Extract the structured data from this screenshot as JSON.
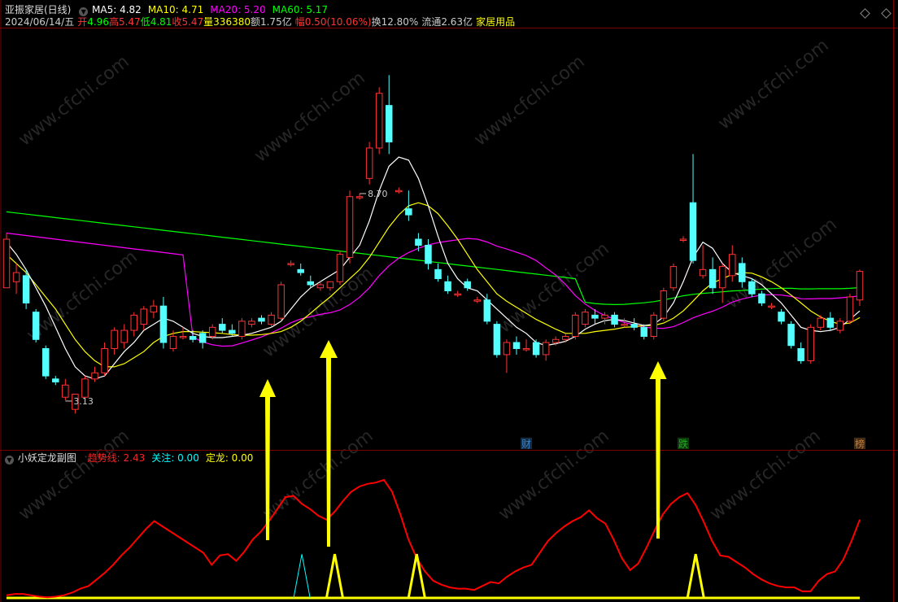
{
  "header": {
    "title": "亚振家居(日线)",
    "ma": [
      {
        "label": "MA5: 4.82",
        "color": "#ffffff"
      },
      {
        "label": "MA10: 4.71",
        "color": "#ffff00"
      },
      {
        "label": "MA20: 5.20",
        "color": "#ff00ff"
      },
      {
        "label": "MA60: 5.17",
        "color": "#00ff00"
      }
    ],
    "quote": [
      {
        "text": "2024/06/14/五",
        "color": "#cccccc"
      },
      {
        "text": "开",
        "color": "#ff3333"
      },
      {
        "text": "4.96",
        "color": "#00ff00"
      },
      {
        "text": "高",
        "color": "#ff3333"
      },
      {
        "text": "5.47",
        "color": "#ff3333"
      },
      {
        "text": "低",
        "color": "#00ff00"
      },
      {
        "text": "4.81",
        "color": "#00ff00"
      },
      {
        "text": "收",
        "color": "#ff3333"
      },
      {
        "text": "5.47",
        "color": "#ff3333"
      },
      {
        "text": "量",
        "color": "#ffff00"
      },
      {
        "text": "336380",
        "color": "#ffff00"
      },
      {
        "text": "额1.75亿",
        "color": "#cccccc"
      },
      {
        "text": "幅",
        "color": "#ff3333"
      },
      {
        "text": "0.50(10.06%)",
        "color": "#ff3333"
      },
      {
        "text": "换12.80%",
        "color": "#cccccc"
      },
      {
        "text": "流通2.63亿",
        "color": "#cccccc"
      },
      {
        "text": "家居用品",
        "color": "#ffff00"
      }
    ]
  },
  "sub_header": {
    "title": "小妖定龙副图",
    "items": [
      {
        "text": "趋势线: 2.43",
        "color": "#ff2222"
      },
      {
        "text": "关注: 0.00",
        "color": "#00ffff"
      },
      {
        "text": "定龙: 0.00",
        "color": "#ffff00"
      }
    ]
  },
  "watermark": "www.cfchi.com",
  "markers": [
    {
      "text": "财",
      "color": "#3b82c4",
      "index": 53
    },
    {
      "text": "跌",
      "color": "#22aa22",
      "index": 69
    },
    {
      "text": "榜",
      "color": "#c27c3a",
      "index": 87
    }
  ],
  "price_labels": [
    {
      "text": "8.70",
      "index": 36
    },
    {
      "text": "3.13",
      "index": 6
    }
  ],
  "colors": {
    "up": "#ff3333",
    "down": "#54ffff",
    "ma5": "#ffffff",
    "ma10": "#ffff00",
    "ma20": "#ff00ff",
    "ma60": "#00ff00",
    "trend": "#ff0000",
    "focus": "#00ffff",
    "dragon": "#ffff00",
    "arrow": "#ffff00",
    "panel_border": "#7a0000"
  },
  "chart_data": [
    {
      "type": "candlestick",
      "title": "亚振家居(日线)",
      "ylim": [
        2.6,
        9.4
      ],
      "candles": [
        [
          5.2,
          6.1,
          5.25,
          6.0
        ],
        [
          5.3,
          5.6,
          5.1,
          5.45
        ],
        [
          5.4,
          5.5,
          4.85,
          4.95
        ],
        [
          4.8,
          4.85,
          4.3,
          4.35
        ],
        [
          4.2,
          4.25,
          3.7,
          3.75
        ],
        [
          3.7,
          3.75,
          3.6,
          3.65
        ],
        [
          3.4,
          3.7,
          3.35,
          3.6
        ],
        [
          3.2,
          3.45,
          3.13,
          3.45
        ],
        [
          3.4,
          3.75,
          3.35,
          3.7
        ],
        [
          3.7,
          3.9,
          3.65,
          3.8
        ],
        [
          3.8,
          4.3,
          3.75,
          4.2
        ],
        [
          4.2,
          4.55,
          4.1,
          4.5
        ],
        [
          4.3,
          4.6,
          4.2,
          4.5
        ],
        [
          4.5,
          4.8,
          4.4,
          4.75
        ],
        [
          4.6,
          4.9,
          4.5,
          4.85
        ],
        [
          4.8,
          5.0,
          4.7,
          4.9
        ],
        [
          4.9,
          5.05,
          4.2,
          4.3
        ],
        [
          4.2,
          4.5,
          4.15,
          4.4
        ],
        [
          4.4,
          4.55,
          4.35,
          4.4
        ],
        [
          4.4,
          4.5,
          4.3,
          4.35
        ],
        [
          4.45,
          4.5,
          4.2,
          4.3
        ],
        [
          4.4,
          4.6,
          4.35,
          4.55
        ],
        [
          4.6,
          4.7,
          4.45,
          4.5
        ],
        [
          4.5,
          4.6,
          4.4,
          4.45
        ],
        [
          4.4,
          4.7,
          4.35,
          4.65
        ],
        [
          4.6,
          4.7,
          4.55,
          4.65
        ],
        [
          4.7,
          4.75,
          4.6,
          4.65
        ],
        [
          4.6,
          4.8,
          4.55,
          4.75
        ],
        [
          4.7,
          5.3,
          4.65,
          5.25
        ],
        [
          5.6,
          5.65,
          5.55,
          5.6
        ],
        [
          5.5,
          5.6,
          5.4,
          5.45
        ],
        [
          5.3,
          5.4,
          5.2,
          5.25
        ],
        [
          5.2,
          5.3,
          5.15,
          5.25
        ],
        [
          5.2,
          5.3,
          5.15,
          5.3
        ],
        [
          5.3,
          5.8,
          5.25,
          5.75
        ],
        [
          5.7,
          6.8,
          5.6,
          6.7
        ],
        [
          6.7,
          6.75,
          6.65,
          6.7
        ],
        [
          7.0,
          7.6,
          6.9,
          7.5
        ],
        [
          7.5,
          8.5,
          7.4,
          8.4
        ],
        [
          8.2,
          8.7,
          7.4,
          7.6
        ],
        [
          6.8,
          6.85,
          6.75,
          6.8
        ],
        [
          6.5,
          6.8,
          6.3,
          6.4
        ],
        [
          6.0,
          6.1,
          5.8,
          5.9
        ],
        [
          5.9,
          6.0,
          5.5,
          5.6
        ],
        [
          5.5,
          5.6,
          5.3,
          5.35
        ],
        [
          5.3,
          5.4,
          5.1,
          5.15
        ],
        [
          5.1,
          5.15,
          5.05,
          5.1
        ],
        [
          5.3,
          5.35,
          5.15,
          5.2
        ],
        [
          5.0,
          5.05,
          4.95,
          5.0
        ],
        [
          5.0,
          5.1,
          4.6,
          4.65
        ],
        [
          4.6,
          4.65,
          4.05,
          4.1
        ],
        [
          4.1,
          4.35,
          3.8,
          4.3
        ],
        [
          4.3,
          4.4,
          4.1,
          4.2
        ],
        [
          4.2,
          4.35,
          4.15,
          4.2
        ],
        [
          4.3,
          4.35,
          4.05,
          4.1
        ],
        [
          4.1,
          4.35,
          4.0,
          4.3
        ],
        [
          4.3,
          4.4,
          4.25,
          4.35
        ],
        [
          4.35,
          4.45,
          4.3,
          4.4
        ],
        [
          4.4,
          4.8,
          4.35,
          4.75
        ],
        [
          4.6,
          4.85,
          4.55,
          4.8
        ],
        [
          4.75,
          4.85,
          4.6,
          4.7
        ],
        [
          4.7,
          4.8,
          4.6,
          4.75
        ],
        [
          4.75,
          4.8,
          4.55,
          4.6
        ],
        [
          4.6,
          4.7,
          4.55,
          4.6
        ],
        [
          4.6,
          4.7,
          4.5,
          4.55
        ],
        [
          4.55,
          4.6,
          4.35,
          4.4
        ],
        [
          4.4,
          4.8,
          4.35,
          4.75
        ],
        [
          4.7,
          5.2,
          4.65,
          5.15
        ],
        [
          5.2,
          5.6,
          5.15,
          5.55
        ],
        [
          6.0,
          6.05,
          5.95,
          6.0
        ],
        [
          6.6,
          7.4,
          5.6,
          5.65
        ],
        [
          5.4,
          5.9,
          5.35,
          5.5
        ],
        [
          5.5,
          5.7,
          5.1,
          5.2
        ],
        [
          5.2,
          5.6,
          4.95,
          5.55
        ],
        [
          5.4,
          5.9,
          5.3,
          5.75
        ],
        [
          5.6,
          5.7,
          5.2,
          5.3
        ],
        [
          5.3,
          5.35,
          5.05,
          5.1
        ],
        [
          5.1,
          5.15,
          4.9,
          4.95
        ],
        [
          4.9,
          4.95,
          4.85,
          4.9
        ],
        [
          4.8,
          4.85,
          4.6,
          4.65
        ],
        [
          4.6,
          4.65,
          4.2,
          4.25
        ],
        [
          4.2,
          4.3,
          3.95,
          4.0
        ],
        [
          4.0,
          4.6,
          3.95,
          4.55
        ],
        [
          4.55,
          4.75,
          4.5,
          4.7
        ],
        [
          4.7,
          4.8,
          4.5,
          4.55
        ],
        [
          4.5,
          4.7,
          4.45,
          4.65
        ],
        [
          4.65,
          5.1,
          4.6,
          5.05
        ],
        [
          5.0,
          5.5,
          4.9,
          5.47
        ]
      ],
      "ma5": [
        5.95,
        5.75,
        5.5,
        5.2,
        4.9,
        4.55,
        4.2,
        3.9,
        3.75,
        3.7,
        3.75,
        3.95,
        4.15,
        4.3,
        4.5,
        4.6,
        4.7,
        4.65,
        4.55,
        4.45,
        4.4,
        4.38,
        4.38,
        4.4,
        4.42,
        4.45,
        4.5,
        4.55,
        4.65,
        4.85,
        5.05,
        5.2,
        5.3,
        5.4,
        5.5,
        5.7,
        5.9,
        6.3,
        6.8,
        7.2,
        7.35,
        7.3,
        7.0,
        6.55,
        6.05,
        5.6,
        5.35,
        5.2,
        5.15,
        5.0,
        4.85,
        4.7,
        4.55,
        4.45,
        4.3,
        4.25,
        4.28,
        4.32,
        4.4,
        4.52,
        4.6,
        4.66,
        4.68,
        4.66,
        4.62,
        4.58,
        4.6,
        4.72,
        4.95,
        5.3,
        5.7,
        5.95,
        5.85,
        5.6,
        5.45,
        5.4,
        5.35,
        5.25,
        5.1,
        4.95,
        4.75,
        4.55,
        4.5,
        4.48,
        4.5,
        4.55,
        4.68,
        4.82
      ],
      "ma10": [
        5.75,
        5.6,
        5.45,
        5.25,
        5.05,
        4.85,
        4.6,
        4.35,
        4.15,
        4.0,
        3.9,
        3.9,
        3.95,
        4.05,
        4.15,
        4.3,
        4.4,
        4.45,
        4.48,
        4.48,
        4.47,
        4.46,
        4.45,
        4.43,
        4.42,
        4.42,
        4.43,
        4.45,
        4.48,
        4.55,
        4.65,
        4.78,
        4.92,
        5.05,
        5.2,
        5.35,
        5.5,
        5.7,
        5.95,
        6.2,
        6.4,
        6.55,
        6.6,
        6.55,
        6.42,
        6.22,
        6.0,
        5.75,
        5.5,
        5.3,
        5.1,
        4.98,
        4.88,
        4.78,
        4.68,
        4.6,
        4.52,
        4.45,
        4.45,
        4.45,
        4.48,
        4.5,
        4.52,
        4.55,
        4.56,
        4.58,
        4.58,
        4.62,
        4.7,
        4.82,
        4.98,
        5.15,
        5.28,
        5.35,
        5.42,
        5.45,
        5.44,
        5.38,
        5.3,
        5.2,
        5.08,
        4.95,
        4.82,
        4.72,
        4.65,
        4.6,
        4.62,
        4.71
      ]
    },
    {
      "type": "line",
      "title": "小妖定龙副图",
      "ylim": [
        0,
        10
      ],
      "series": [
        {
          "name": "趋势线",
          "values": [
            0.2,
            0.3,
            0.3,
            0.2,
            0.1,
            0.05,
            0.1,
            0.2,
            0.4,
            0.7,
            0.9,
            1.4,
            1.9,
            2.5,
            3.2,
            3.8,
            4.5,
            5.2,
            5.8,
            5.4,
            5.0,
            4.6,
            4.2,
            3.8,
            3.4,
            2.5,
            3.2,
            3.3,
            2.8,
            3.5,
            4.4,
            5.0,
            5.8,
            6.7,
            7.6,
            7.7,
            7.1,
            6.7,
            6.2,
            5.9,
            6.5,
            7.3,
            8.0,
            8.4,
            8.6,
            8.7,
            8.9,
            8.0,
            6.3,
            4.4,
            3.0,
            2.0,
            1.3,
            1.0,
            0.8,
            0.7,
            0.7,
            0.6,
            0.9,
            1.2,
            1.1,
            1.6,
            2.0,
            2.3,
            2.5,
            3.4,
            4.3,
            4.9,
            5.4,
            5.8,
            6.1,
            6.6,
            6.0,
            5.6,
            4.4,
            3.0,
            2.1,
            2.6,
            3.8,
            5.1,
            6.3,
            7.1,
            7.6,
            7.9,
            7.0,
            5.7,
            4.3,
            3.2,
            3.1,
            2.7,
            2.3,
            1.8,
            1.4,
            1.1,
            0.9,
            0.8,
            0.8,
            0.5,
            0.5,
            1.3,
            1.8,
            2.0,
            2.9,
            4.3,
            5.9
          ]
        },
        {
          "name": "关注",
          "values": [
            0,
            0,
            0,
            0,
            0,
            0,
            0,
            0,
            0,
            0,
            0,
            0,
            0,
            0,
            0,
            0,
            0,
            0,
            0,
            0,
            0,
            0,
            0,
            0,
            0,
            0,
            0,
            0,
            0,
            0,
            0,
            0,
            0,
            0,
            0,
            0,
            3.3,
            0,
            0,
            0,
            0,
            0,
            0,
            0,
            0,
            0,
            0,
            0,
            0,
            0,
            0,
            0,
            0,
            0,
            0,
            0,
            0,
            0,
            0,
            0,
            0,
            0,
            0,
            0,
            0,
            0,
            0,
            0,
            0,
            0,
            0,
            0,
            0,
            0,
            0,
            0,
            0,
            0,
            0,
            0,
            0,
            0,
            0,
            0,
            0,
            0,
            0,
            0,
            0,
            0,
            0,
            0,
            0,
            0,
            0,
            0,
            0,
            0,
            0,
            0,
            0,
            0,
            0,
            0,
            0
          ]
        },
        {
          "name": "定龙",
          "values": [
            0,
            0,
            0,
            0,
            0,
            0,
            0,
            0,
            0,
            0,
            0,
            0,
            0,
            0,
            0,
            0,
            0,
            0,
            0,
            0,
            0,
            0,
            0,
            0,
            0,
            0,
            0,
            0,
            0,
            0,
            0,
            0,
            0,
            0,
            0,
            0,
            0,
            0,
            0,
            0,
            3.3,
            0,
            0,
            0,
            0,
            0,
            0,
            0,
            0,
            0,
            3.3,
            0,
            0,
            0,
            0,
            0,
            0,
            0,
            0,
            0,
            0,
            0,
            0,
            0,
            0,
            0,
            0,
            0,
            0,
            0,
            0,
            0,
            0,
            0,
            0,
            0,
            0,
            0,
            0,
            0,
            0,
            0,
            0,
            0,
            0,
            0,
            0,
            0,
            0,
            0,
            0,
            0,
            0,
            0,
            0,
            0,
            0,
            0,
            0,
            0,
            0,
            0,
            0,
            0,
            0
          ]
        }
      ]
    }
  ]
}
